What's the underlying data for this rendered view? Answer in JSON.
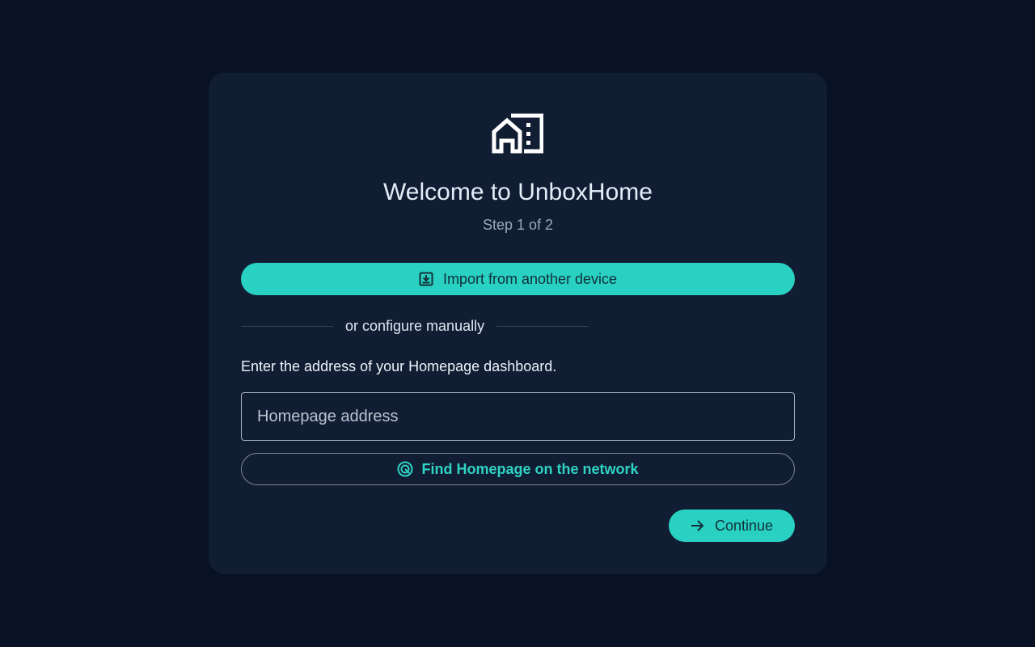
{
  "colors": {
    "background": "#081224",
    "card": "#111d33",
    "accent": "#29d1c2",
    "accent_text": "#2fd3c4",
    "title_text": "#e3ecf7",
    "muted_text": "#9aa9bd"
  },
  "logo": {
    "icon": "home-building-icon"
  },
  "header": {
    "title": "Welcome to UnboxHome",
    "step": "Step 1 of 2"
  },
  "import_button": {
    "icon": "download-box-icon",
    "label": "Import from another device"
  },
  "divider": {
    "label": "or configure manually"
  },
  "form": {
    "instructions": "Enter the address of your Homepage dashboard.",
    "address_value": "",
    "address_placeholder": "Homepage address"
  },
  "find_button": {
    "icon": "radar-icon",
    "label": "Find Homepage on the network"
  },
  "continue_button": {
    "icon": "arrow-right-icon",
    "label": "Continue"
  }
}
